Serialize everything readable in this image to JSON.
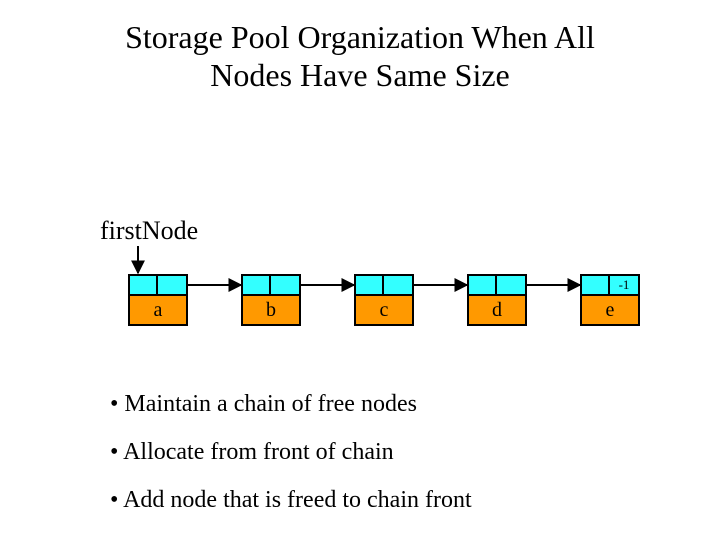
{
  "title_line1": "Storage Pool Organization When All",
  "title_line2": "Nodes Have Same Size",
  "firstNodeLabel": "firstNode",
  "nullValue": "-1",
  "nodes": {
    "n0": "a",
    "n1": "b",
    "n2": "c",
    "n3": "d",
    "n4": "e"
  },
  "bullets": {
    "b0": "• Maintain a chain of free nodes",
    "b1": "• Allocate from front of chain",
    "b2": "• Add node that is freed to chain front"
  }
}
